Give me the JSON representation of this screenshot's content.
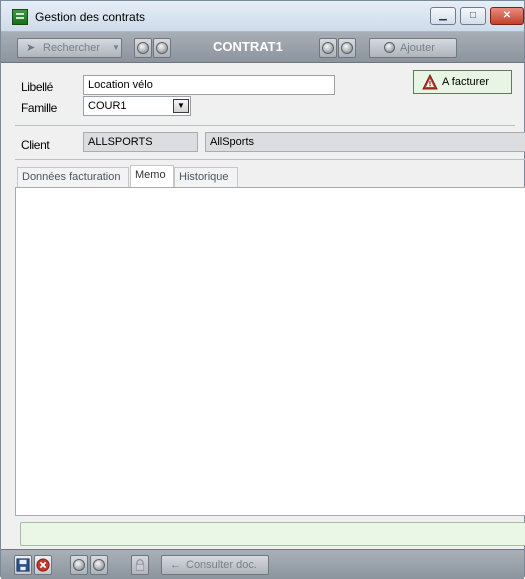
{
  "window": {
    "title": "Gestion des contrats",
    "icons": {
      "app": "app-icon",
      "minimize": "minimize-icon",
      "maximize": "maximize-icon",
      "close": "close-icon"
    }
  },
  "toolbar": {
    "search_label": "Rechercher",
    "contract_title": "CONTRAT1",
    "add_label": "Ajouter"
  },
  "form": {
    "libelle_label": "Libellé",
    "libelle_value": "Location vélo",
    "famille_label": "Famille",
    "famille_value": "COUR1",
    "client_label": "Client",
    "client_code": "ALLSPORTS",
    "client_name": "AllSports"
  },
  "status": {
    "label": "A facturer",
    "color": "#c0392b"
  },
  "tabs": [
    {
      "label": "Données facturation",
      "active": false
    },
    {
      "label": "Memo",
      "active": true
    },
    {
      "label": "Historique",
      "active": false
    }
  ],
  "memo": {
    "content": ""
  },
  "bottom_toolbar": {
    "consult_label": "Consulter doc.",
    "icons": {
      "save": "save-icon",
      "cancel": "cancel-icon",
      "lock": "lock-icon"
    }
  },
  "colors": {
    "accent_green": "#eaf7e6",
    "toolbar_gray": "#9aa1a9"
  }
}
